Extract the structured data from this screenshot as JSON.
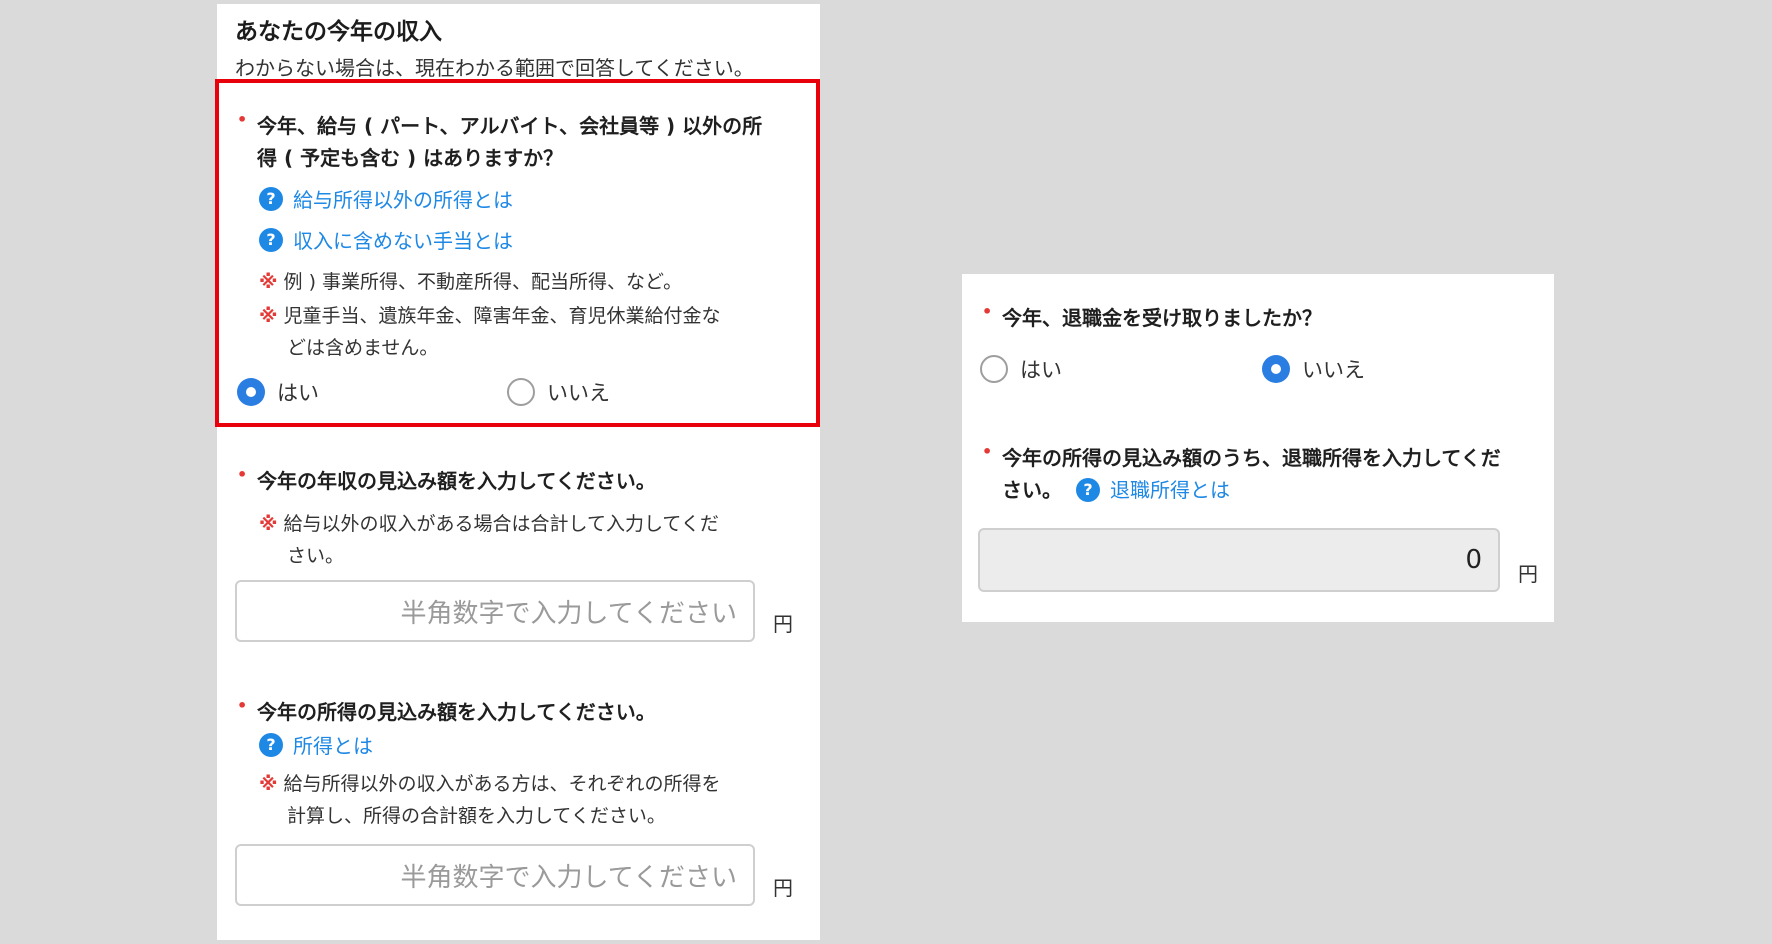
{
  "left": {
    "heading": "あなたの今年の収入",
    "subheading": "わからない場合は、現在わかる範囲で回答してください。",
    "q1": {
      "line1": "今年、給与 ( パート、アルバイト、会社員等 ) 以外の所",
      "line2": "得 ( 予定も含む ) はありますか？",
      "help1": "給与所得以外の所得とは",
      "help2": "収入に含めない手当とは",
      "note1": "例 ) 事業所得、不動産所得、配当所得、など。",
      "note2_line1": "児童手当、遺族年金、障害年金、育児休業給付金な",
      "note2_line2": "どは含めません。",
      "yes": "はい",
      "no": "いいえ",
      "selected": "はい"
    },
    "q2": {
      "label": "今年の年収の見込み額を入力してください。",
      "note_line1": "給与以外の収入がある場合は合計して入力してくだ",
      "note_line2": "さい。",
      "placeholder": "半角数字で入力してください",
      "unit": "円"
    },
    "q3": {
      "label": "今年の所得の見込み額を入力してください。",
      "help": "所得とは",
      "note_line1": "給与所得以外の収入がある方は、それぞれの所得を",
      "note_line2": "計算し、所得の合計額を入力してください。",
      "placeholder": "半角数字で入力してください",
      "unit": "円"
    }
  },
  "right": {
    "q4": {
      "label": "今年、退職金を受け取りましたか？",
      "yes": "はい",
      "no": "いいえ",
      "selected": "いいえ"
    },
    "q5": {
      "line1": "今年の所得の見込み額のうち、退職所得を入力してくだ",
      "line2": "さい。",
      "help": "退職所得とは",
      "value": "0",
      "unit": "円"
    }
  },
  "symbols": {
    "required": "•",
    "kome": "※",
    "question_icon": "?"
  },
  "colors": {
    "accent": "#1e88e5",
    "required": "#e53935",
    "highlight": "#e8000b",
    "radio_on": "#2a7de1"
  }
}
